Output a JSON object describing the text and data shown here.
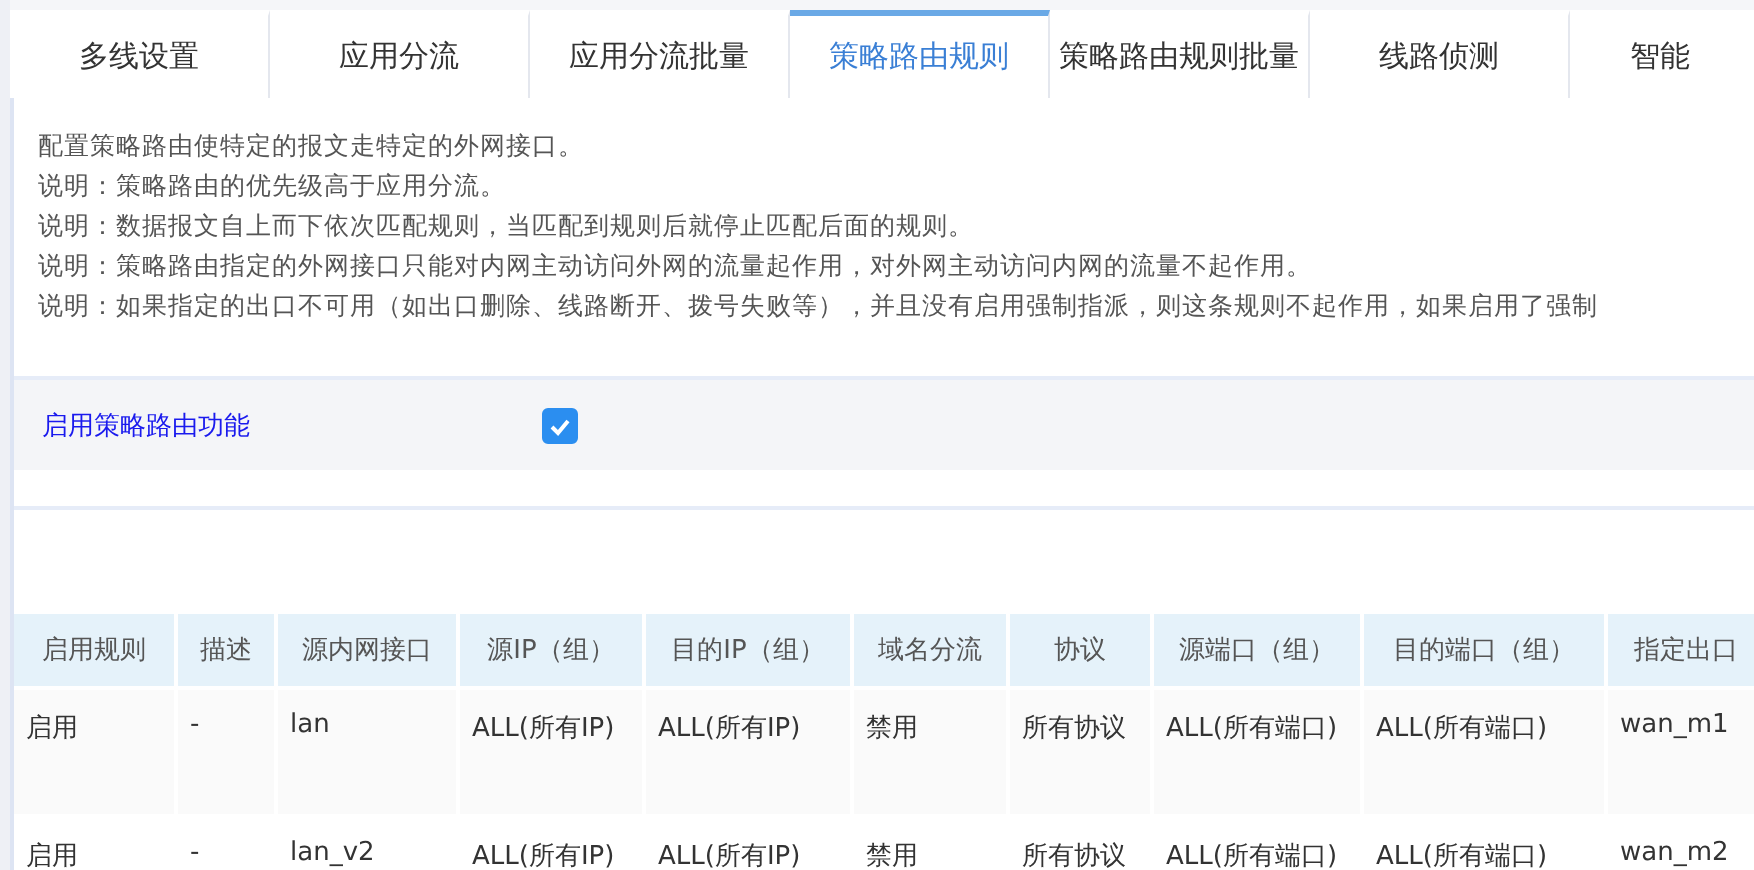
{
  "tabs": [
    {
      "label": "多线设置",
      "selected": false
    },
    {
      "label": "应用分流",
      "selected": false
    },
    {
      "label": "应用分流批量",
      "selected": false
    },
    {
      "label": "策略路由规则",
      "selected": true
    },
    {
      "label": "策略路由规则批量",
      "selected": false
    },
    {
      "label": "线路侦测",
      "selected": false
    },
    {
      "label": "智能",
      "selected": false
    }
  ],
  "notes": [
    "配置策略路由使特定的报文走特定的外网接口。",
    "说明：策略路由的优先级高于应用分流。",
    "说明：数据报文自上而下依次匹配规则，当匹配到规则后就停止匹配后面的规则。",
    "说明：策略路由指定的外网接口只能对内网主动访问外网的流量起作用，对外网主动访问内网的流量不起作用。",
    "说明：如果指定的出口不可用（如出口删除、线路断开、拨号失败等），并且没有启用强制指派，则这条规则不起作用，如果启用了强制"
  ],
  "enable": {
    "label": "启用策略路由功能",
    "checked": true
  },
  "table": {
    "columns": [
      "启用规则",
      "描述",
      "源内网接口",
      "源IP（组）",
      "目的IP（组）",
      "域名分流",
      "协议",
      "源端口（组）",
      "目的端口（组）",
      "指定出口"
    ],
    "rows": [
      [
        "启用",
        "-",
        "lan",
        "ALL(所有IP)",
        "ALL(所有IP)",
        "禁用",
        "所有协议",
        "ALL(所有端口)",
        "ALL(所有端口)",
        "wan_m1"
      ],
      [
        "启用",
        "-",
        "lan_v2",
        "ALL(所有IP)",
        "ALL(所有IP)",
        "禁用",
        "所有协议",
        "ALL(所有端口)",
        "ALL(所有端口)",
        "wan_m2"
      ]
    ]
  }
}
